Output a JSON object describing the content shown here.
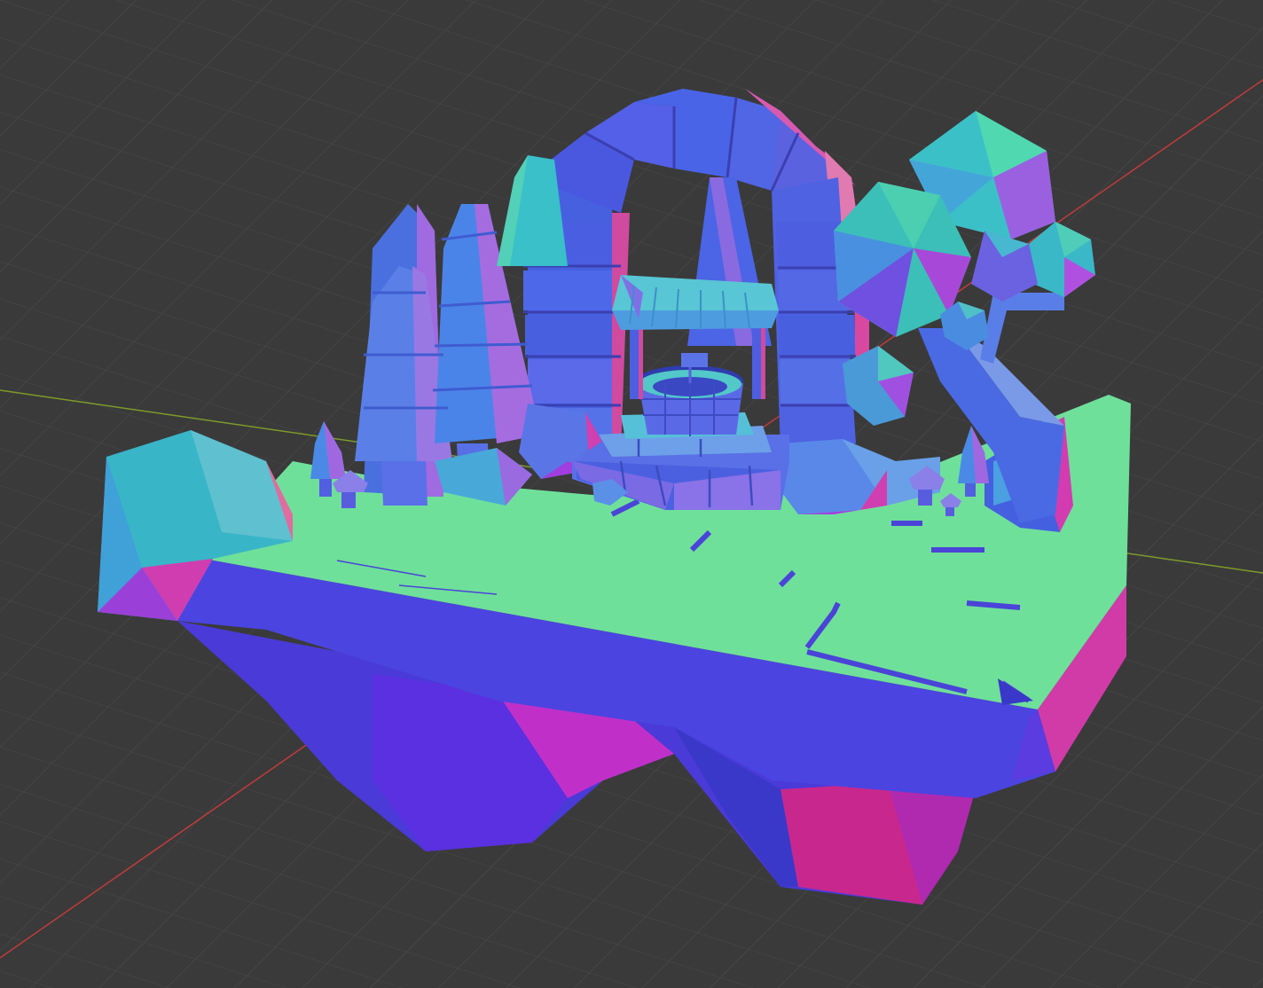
{
  "viewport": {
    "background_color": "#3a3a3a",
    "grid_color": "#4a4a4a",
    "x_axis_color": "#c23b3b",
    "y_axis_color": "#7f9a2a",
    "shading": "normal-map"
  },
  "scene": {
    "objects": [
      "floating-island",
      "stone-arch",
      "stone-well",
      "well-roof",
      "well-steps",
      "pine-tree",
      "round-tree",
      "boulder",
      "mushroom",
      "dirt-path"
    ]
  }
}
